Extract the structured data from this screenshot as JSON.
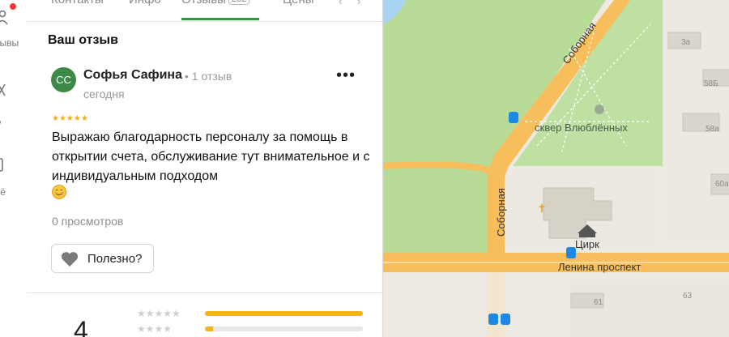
{
  "rail": {
    "label_1": "зывы",
    "label_2": "д",
    "label_3": "ьё"
  },
  "tabs": [
    {
      "label": "Контакты"
    },
    {
      "label": "Инфо"
    },
    {
      "label": "Отзывы",
      "count": "282"
    },
    {
      "label": "Цены"
    }
  ],
  "review": {
    "section_title": "Ваш отзыв",
    "avatar_initials": "СС",
    "author": "Софья Сафина",
    "author_meta": "• 1 отзыв",
    "date": "сегодня",
    "stars": "★★★★★",
    "rating": 5,
    "text": "Выражаю благодарность персоналу за помощь в открытии счета, обслуживание тут внимательное и с индивидуальным подходом",
    "views": "0 просмотров",
    "useful_label": "Полезно?"
  },
  "ratings_summary": {
    "average": "4",
    "rows": [
      {
        "stars": "★★★★★",
        "fraction": 1.0
      },
      {
        "stars": "★★★★",
        "fraction": 0.05
      }
    ]
  },
  "map": {
    "street_sobornaya_1": "Соборная",
    "street_sobornaya_2": "Соборная",
    "park": "сквер Влюблённых",
    "circus": "Цирк",
    "avenue": "Ленина проспект",
    "house_3a": "3а",
    "house_58b": "58Б",
    "house_58a": "58а",
    "house_60a": "60а",
    "house_61": "61",
    "house_63": "63"
  },
  "colors": {
    "accent_green": "#2a9a3c",
    "star_gold": "#f2b01b",
    "avatar_green": "#3c8a46",
    "road_orange": "#f8be5c",
    "park_green": "#bfe0a3"
  }
}
